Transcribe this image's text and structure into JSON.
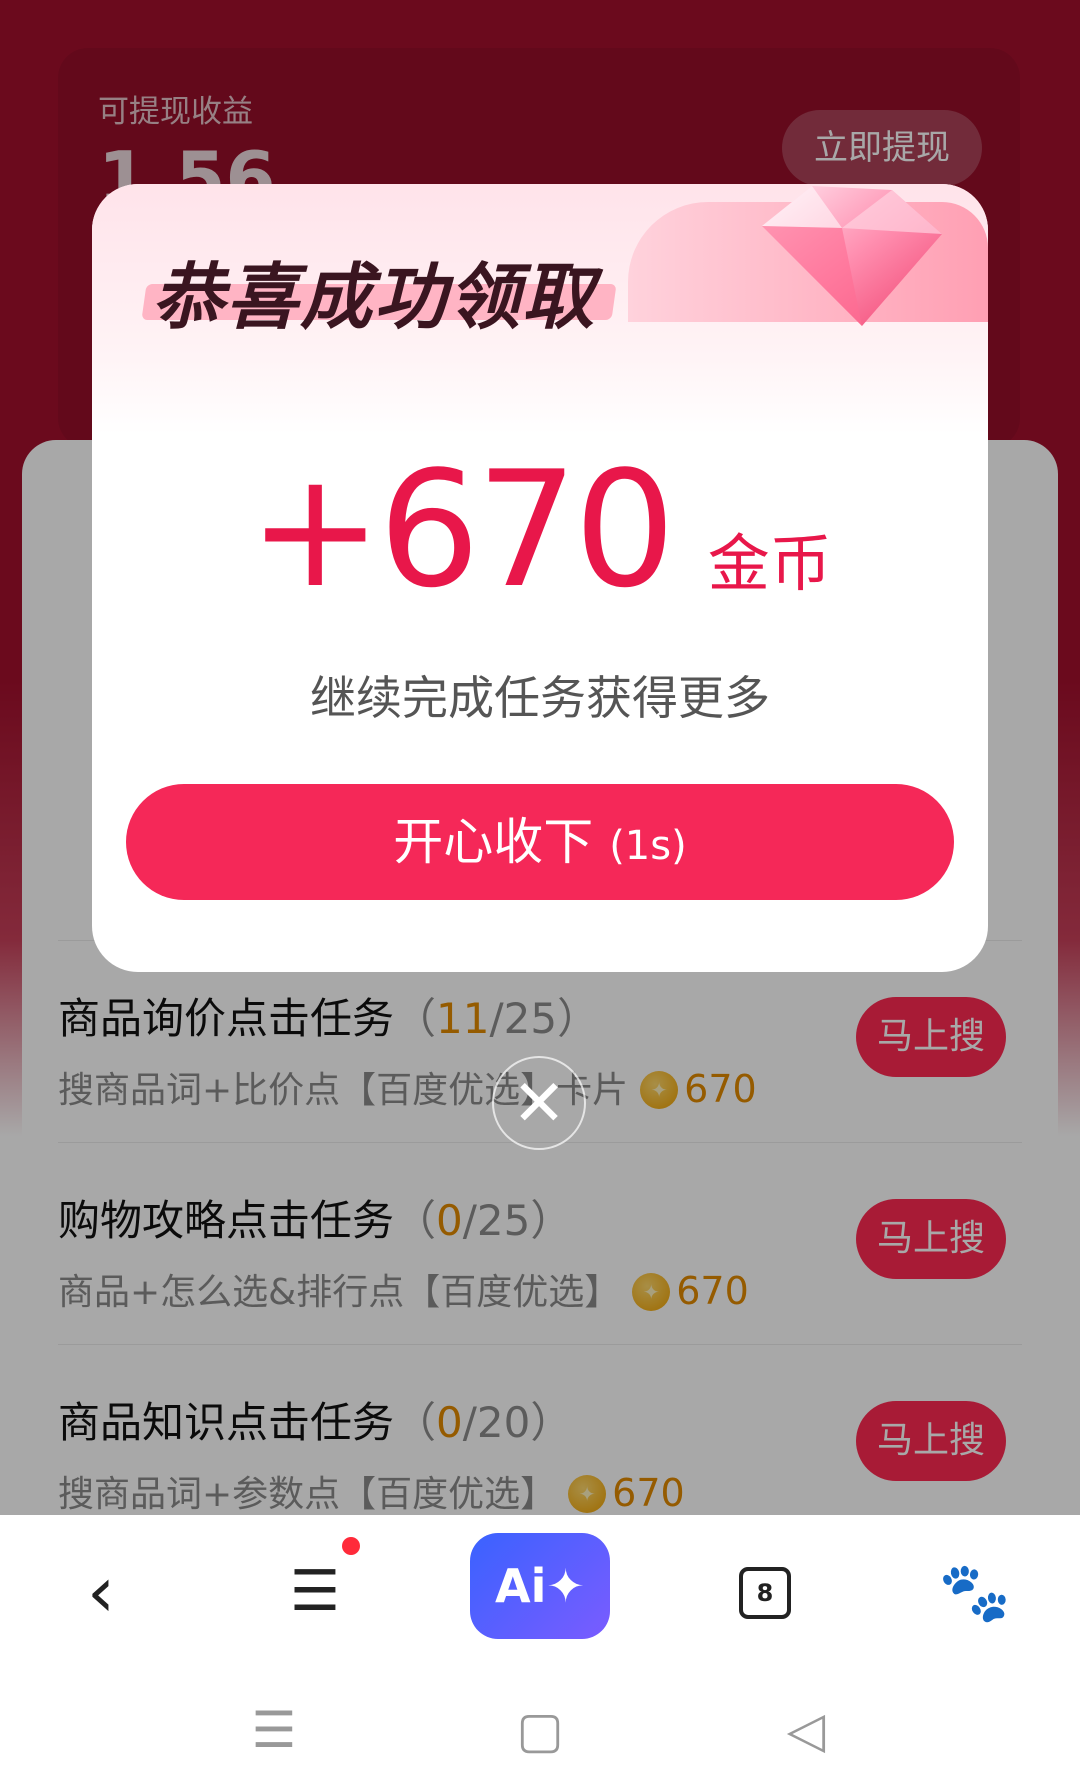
{
  "background": {
    "earnings_label": "可提现收益",
    "earnings_value": "1.56",
    "withdraw_button": "立即提现"
  },
  "tasks": [
    {
      "title": "商品询价点击任务",
      "progress_done": "11",
      "progress_total": "25",
      "subtitle": "搜商品词+比价点【百度优选】卡片",
      "reward": "670",
      "button": "马上搜"
    },
    {
      "title": "购物攻略点击任务",
      "progress_done": "0",
      "progress_total": "25",
      "subtitle": "商品+怎么选&排行点【百度优选】",
      "reward": "670",
      "button": "马上搜"
    },
    {
      "title": "商品知识点击任务",
      "progress_done": "0",
      "progress_total": "20",
      "subtitle": "搜商品词+参数点【百度优选】",
      "reward": "670",
      "button": "马上搜"
    }
  ],
  "modal": {
    "title": "恭喜成功领取",
    "amount": "+670",
    "unit": "金币",
    "subtitle": "继续完成任务获得更多",
    "button_label": "开心收下",
    "button_countdown": "(1s)",
    "close_symbol": "✕"
  },
  "browser_bar": {
    "back_icon": "‹",
    "menu_icon": "☰",
    "ai_label": "Ai✦",
    "tab_count": "8",
    "baidu_icon": "🐾"
  },
  "system_bar": {
    "menu_icon": "☰",
    "home_icon": "▢",
    "back_icon": "◁"
  },
  "colors": {
    "accent": "#f52858",
    "amount": "#e8174a",
    "header_bg": "#a3102d",
    "reward": "#e38a00"
  }
}
